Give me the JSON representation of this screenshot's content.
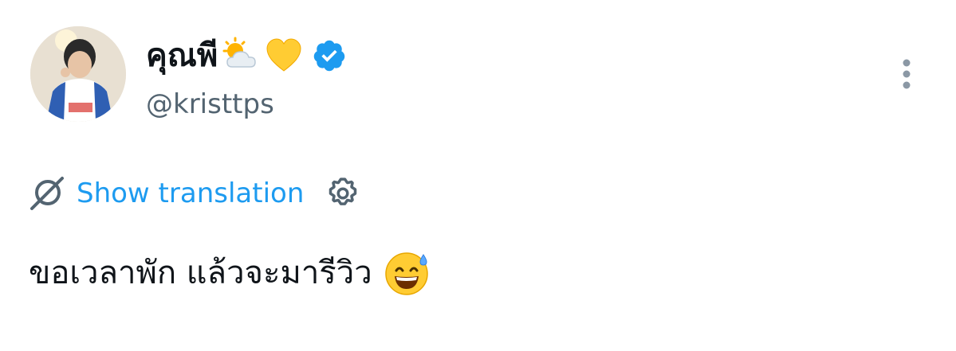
{
  "author": {
    "display_name": "คุณพี",
    "display_name_emojis": [
      "sun-behind-cloud-icon",
      "yellow-heart-icon"
    ],
    "verified": true,
    "handle": "@kristtps"
  },
  "translation": {
    "show_label": "Show translation"
  },
  "tweet": {
    "text": "ขอเวลาพัก แล้วจะมารีวิว",
    "trailing_emoji": "grinning-face-with-sweat-icon"
  },
  "colors": {
    "accent": "#1d9bf0",
    "text_primary": "#0f1419",
    "text_secondary": "#536471",
    "heart": "#ffcc33"
  }
}
